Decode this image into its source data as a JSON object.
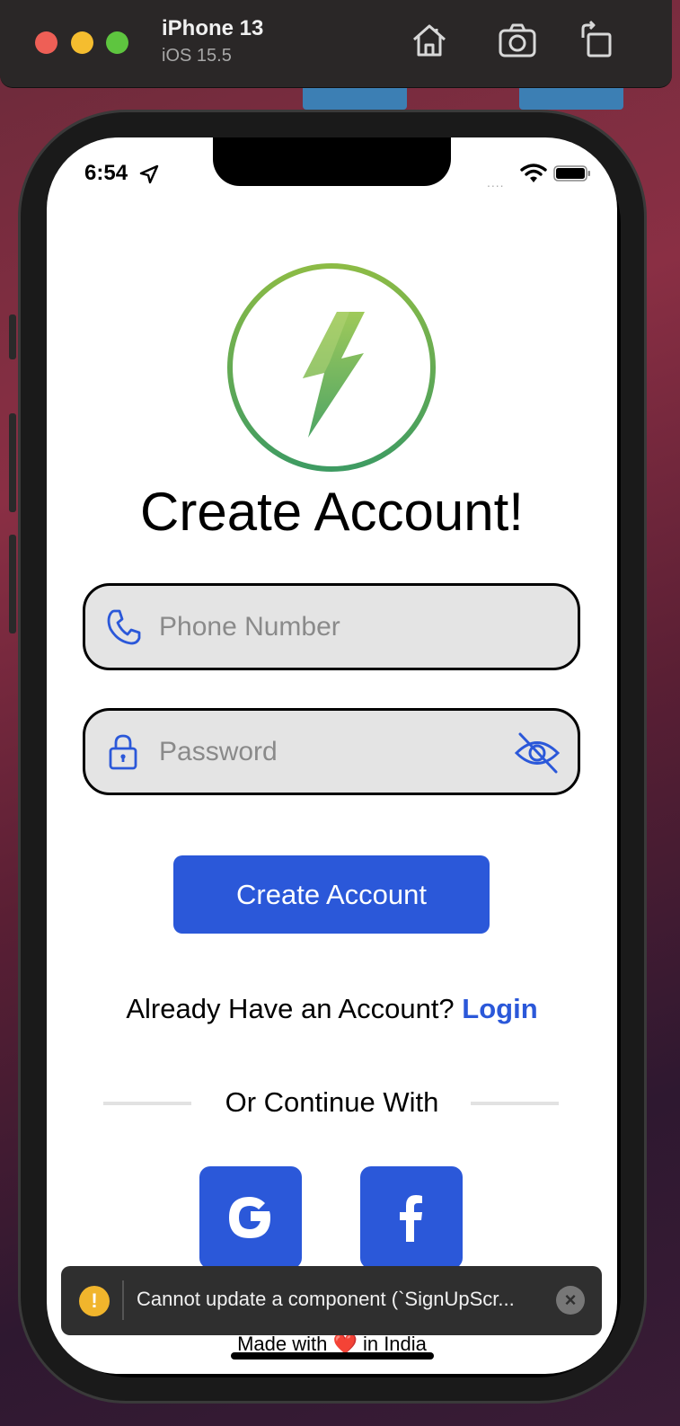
{
  "simulator": {
    "device_name": "iPhone 13",
    "os_version": "iOS 15.5",
    "buttons": [
      "home-icon",
      "screenshot-icon",
      "rotate-icon"
    ]
  },
  "status_bar": {
    "time": "6:54",
    "signal": "....",
    "icons": [
      "location-arrow-icon",
      "wifi-icon",
      "battery-icon"
    ]
  },
  "signup": {
    "title": "Create Account!",
    "phone_placeholder": "Phone Number",
    "password_placeholder": "Password",
    "create_button": "Create Account",
    "already_text": "Already Have an Account?",
    "login_link": "Login",
    "or_continue": "Or Continue With",
    "social": [
      {
        "name": "google",
        "icon": "google-icon"
      },
      {
        "name": "facebook",
        "icon": "facebook-icon"
      }
    ],
    "footer": "Made with ❤️ in India"
  },
  "toast": {
    "warning_icon": "!",
    "message": "Cannot update a component (`SignUpScr...",
    "close_icon": "×"
  },
  "colors": {
    "accent_blue": "#2b58d9",
    "field_bg": "#e4e4e4",
    "logo_green": "#6fae4b",
    "toast_bg": "#2f2f2f",
    "warning_yellow": "#f1b52c"
  }
}
